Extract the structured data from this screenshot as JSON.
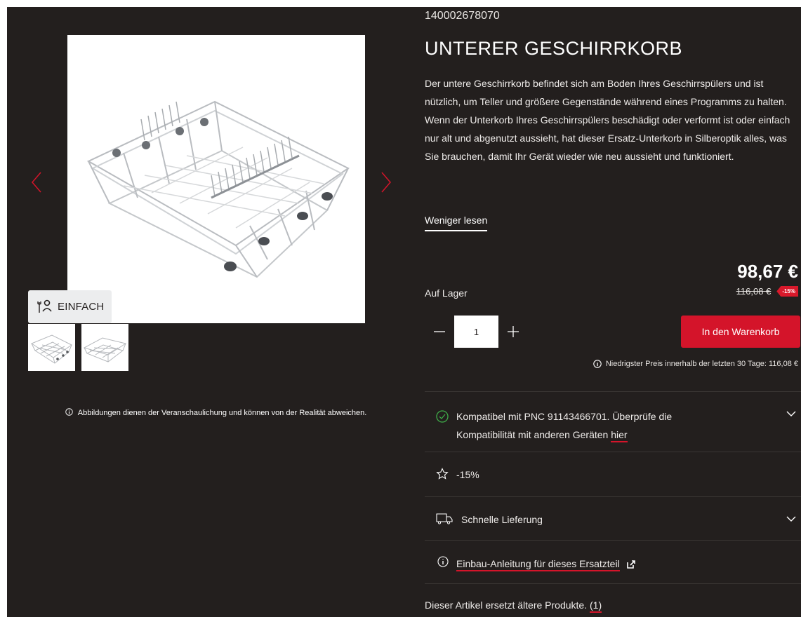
{
  "product": {
    "sku": "140002678070",
    "title": "UNTERER GESCHIRRKORB",
    "description": "Der untere Geschirrkorb befindet sich am Boden Ihres Geschirrspülers und ist nützlich, um Teller und größere Gegenstände während eines Programms zu halten. Wenn der Unterkorb Ihres Geschirrspülers beschädigt oder verformt ist oder einfach nur alt und abgenutzt aussieht, hat dieser Ersatz-Unterkorb in Silberoptik alles, was Sie brauchen, damit Ihr Gerät wieder wie neu aussieht und funktioniert.",
    "read_less": "Weniger lesen"
  },
  "gallery": {
    "difficulty_badge": "EINFACH",
    "disclaimer": "Abbildungen dienen der Veranschaulichung und können von der Realität abweichen."
  },
  "pricing": {
    "price": "98,67 €",
    "old_price": "116,08 €",
    "discount": "-15%",
    "stock": "Auf Lager",
    "quantity": "1",
    "add_to_cart": "In den Warenkorb",
    "lowest_price_note": "Niedrigster Preis innerhalb der letzten 30 Tage: 116,08 €"
  },
  "features": {
    "compat_text": "Kompatibel mit PNC 91143466701. Überprüfe die Kompatibilität mit anderen Geräten",
    "compat_link": "hier",
    "promo": "-15%",
    "delivery": "Schnelle Lieferung",
    "manual_link": "Einbau-Anleitung für dieses Ersatzteil",
    "replaces_text": "Dieser Artikel ersetzt ältere Produkte.",
    "replaces_count": "(1)"
  },
  "colors": {
    "page_background": "#231f1e",
    "accent_red": "#d4142a",
    "compat_green": "#3fae49"
  }
}
